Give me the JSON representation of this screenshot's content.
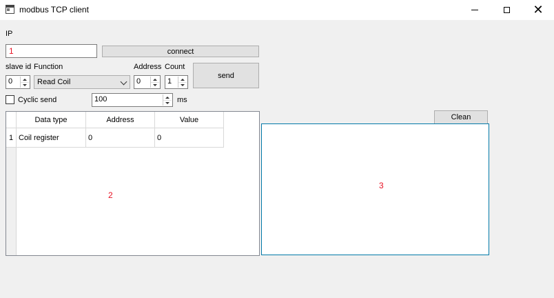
{
  "window": {
    "title": "modbus TCP client",
    "app_icon": "window-app-icon",
    "controls": {
      "minimize": "minimize-icon",
      "maximize": "maximize-icon",
      "close": "close-icon",
      "close_glyph": "✕"
    }
  },
  "connection": {
    "ip_label": "IP",
    "ip_value": "",
    "ip_annotation": "1",
    "connect_label": "connect"
  },
  "request": {
    "slave_id_label": "slave id",
    "slave_id_value": "0",
    "function_label": "Function",
    "function_value": "Read Coil",
    "address_label": "Address",
    "address_value": "0",
    "count_label": "Count",
    "count_value": "1",
    "send_label": "send"
  },
  "cyclic": {
    "label": "Cyclic send",
    "checked": false,
    "interval_value": "100",
    "unit": "ms"
  },
  "table": {
    "columns": [
      "Data type",
      "Address",
      "Value"
    ],
    "rows": [
      {
        "header": "1",
        "cells": [
          "Coil register",
          "0",
          "0"
        ]
      }
    ],
    "annotation": "2"
  },
  "log": {
    "clean_label": "Clean",
    "annotation": "3"
  },
  "colors": {
    "annotation": "#e81123",
    "log_border": "#0078a8"
  }
}
